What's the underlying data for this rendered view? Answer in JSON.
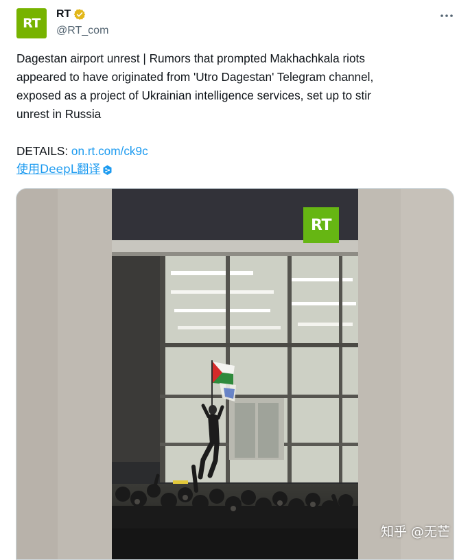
{
  "author": {
    "avatar_text": "RT",
    "name": "RT",
    "handle": "@RT_com",
    "verified_badge": "gold-verified-badge",
    "avatar_color": "#77b300"
  },
  "more_icon": "more-horizontal-icon",
  "tweet": {
    "lines": [
      "Dagestan airport unrest | Rumors that prompted Makhachkala riots",
      "appeared to have originated from 'Utro Dagestan' Telegram channel,",
      "exposed as a project of Ukrainian intelligence services, set up to stir",
      "unrest in Russia"
    ],
    "details_label": "DETAILS: ",
    "details_link": "on.rt.com/ck9c",
    "translate_label": "使用DeepL翻译",
    "translate_icon": "deepl-badge-icon"
  },
  "media": {
    "logo_text": "RT",
    "logo_color": "#66b613"
  },
  "watermark": "知乎 @无芒",
  "colors": {
    "link": "#1d9bf0",
    "text": "#0f1419",
    "secondary": "#536471"
  }
}
